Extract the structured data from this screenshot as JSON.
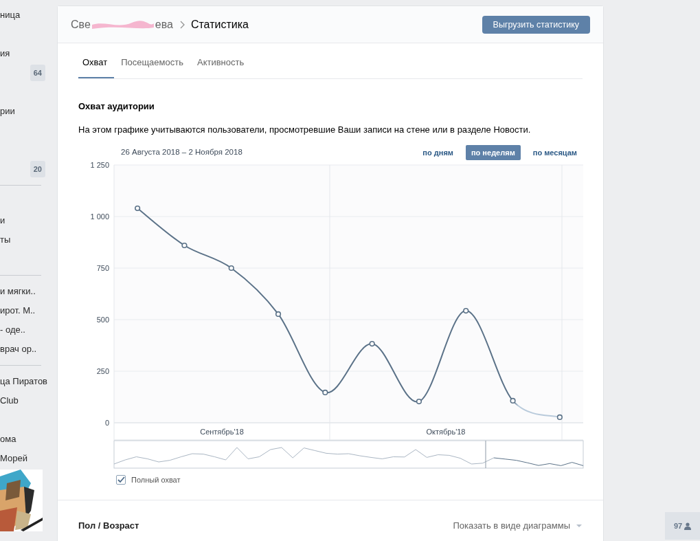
{
  "sidebar": {
    "items": [
      {
        "kind": "link",
        "label": "ница"
      },
      {
        "kind": "blank"
      },
      {
        "kind": "link",
        "label": "ия"
      },
      {
        "kind": "badge",
        "badge": "64"
      },
      {
        "kind": "blank"
      },
      {
        "kind": "link",
        "label": "рии"
      },
      {
        "kind": "blank"
      },
      {
        "kind": "blank"
      },
      {
        "kind": "badge",
        "badge": "20"
      },
      {
        "kind": "divider"
      },
      {
        "kind": "blank"
      },
      {
        "kind": "link",
        "label": "и"
      },
      {
        "kind": "link",
        "label": "ты"
      },
      {
        "kind": "blank"
      },
      {
        "kind": "divider"
      },
      {
        "kind": "link",
        "label": "и мягки.."
      },
      {
        "kind": "link",
        "label": "ирот. М.."
      },
      {
        "kind": "link",
        "label": "- оде.."
      },
      {
        "kind": "link",
        "label": "врач ор.."
      },
      {
        "kind": "divider"
      },
      {
        "kind": "link",
        "label": "ца Пиратов"
      },
      {
        "kind": "link",
        "label": "Club"
      },
      {
        "kind": "blank"
      },
      {
        "kind": "link",
        "label": "ома"
      },
      {
        "kind": "link",
        "label": "Морей"
      },
      {
        "kind": "picture"
      }
    ]
  },
  "header": {
    "breadcrumb_parent_start": "Све",
    "breadcrumb_parent_end": "ева",
    "breadcrumb_current": "Статистика",
    "export_button": "Выгрузить статистику"
  },
  "tabs": [
    {
      "label": "Охват",
      "selected": true
    },
    {
      "label": "Посещаемость",
      "selected": false
    },
    {
      "label": "Активность",
      "selected": false
    }
  ],
  "reach": {
    "title": "Охват аудитории",
    "description": "На этом графике учитываются пользователи, просмотревшие Ваши записи на стене или в разделе Новости.",
    "date_range": "26 Августа 2018 – 2 Ноября 2018",
    "periods": [
      {
        "label": "по дням",
        "selected": false
      },
      {
        "label": "по неделям",
        "selected": true
      },
      {
        "label": "по месяцам",
        "selected": false
      }
    ],
    "month_labels": [
      "Сентябрь'18",
      "Октябрь'18"
    ],
    "chart_data": {
      "type": "line",
      "categories": [
        null,
        null,
        null,
        null,
        null,
        null,
        null,
        null,
        null,
        null
      ],
      "grid": true,
      "ylim": [
        0,
        1250
      ],
      "series": [
        {
          "name": "Полный охват",
          "color": "#5b7288",
          "marker": "circle",
          "values": [
            1040,
            860,
            750,
            527,
            147,
            383,
            103,
            543,
            107,
            27
          ]
        }
      ],
      "yticks": [
        {
          "value": 0,
          "label": "0"
        },
        {
          "value": 250,
          "label": "250"
        },
        {
          "value": 500,
          "label": "500"
        },
        {
          "value": 750,
          "label": "750"
        },
        {
          "value": 1000,
          "label": "1 000"
        },
        {
          "value": 1250,
          "label": "1 250"
        }
      ]
    },
    "legend": [
      {
        "checked": true
      }
    ]
  },
  "gender_age": {
    "title": "Пол / Возраст",
    "view_toggle": "Показать в виде диаграммы"
  },
  "online_count": "97"
}
